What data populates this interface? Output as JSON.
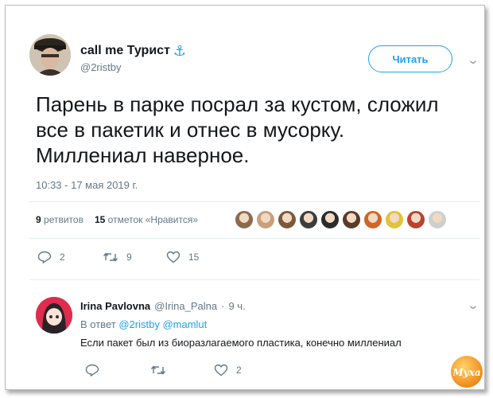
{
  "tweet": {
    "author_name": "call me Турист",
    "author_handle": "@2ristby",
    "follow_label": "Читать",
    "text": "Парень в парке посрал за кустом, сложил\nвсе в пакетик и отнес в мусорку.\nМиллениал наверное.",
    "timestamp": "10:33 - 17 мая 2019 г.",
    "retweets_count": "9",
    "retweets_label": "ретвитов",
    "likes_count": "15",
    "likes_label": "отметок «Нравится»",
    "reply_count": "2",
    "retweet_count": "9",
    "like_count": "15",
    "liker_colors": [
      "#8a6a50",
      "#c9a07a",
      "#7b5a3c",
      "#3d3d3d",
      "#2b2b2b",
      "#5a3a2a",
      "#d0652a",
      "#e2c23a",
      "#b9432f",
      "#cfcfcf"
    ]
  },
  "reply": {
    "author_name": "Irina Pavlovna",
    "author_handle": "@Irina_Palna",
    "time": "9 ч.",
    "reply_prefix": "В ответ",
    "mention_1": "@2ristby",
    "mention_2": "@mamlut",
    "text": "Если пакет был из биоразлагаемого пластика, конечно миллениал",
    "reply_count": "",
    "retweet_count": "",
    "like_count": "2"
  },
  "colors": {
    "accent": "#1da1f2",
    "muted": "#657786",
    "text": "#14171a"
  },
  "watermark_text": "Муха"
}
